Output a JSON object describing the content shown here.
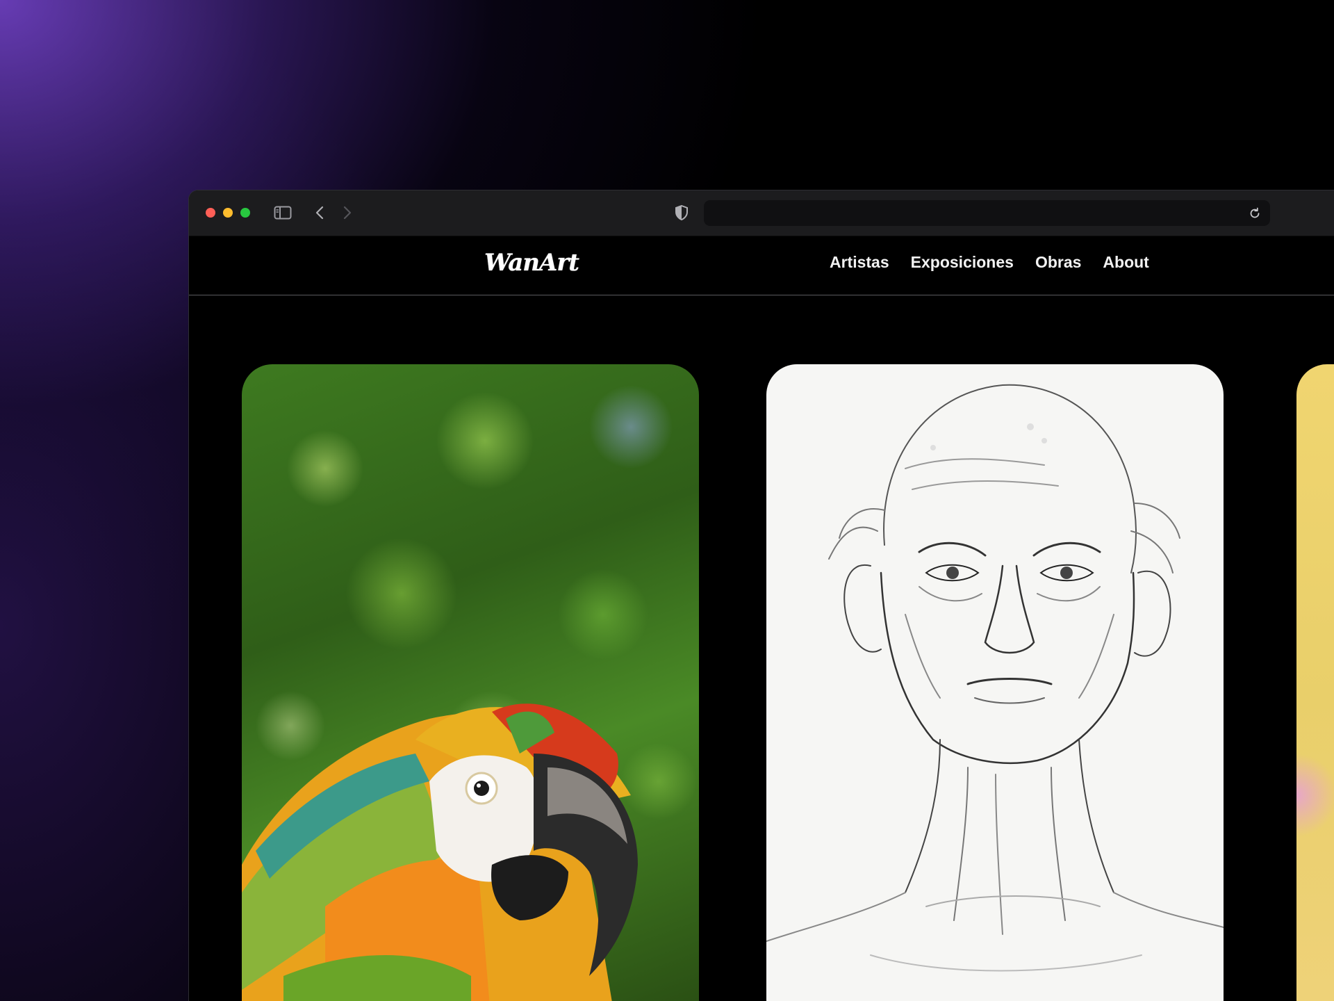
{
  "browser": {
    "traffic_lights": {
      "close_color": "#ff5f57",
      "minimize_color": "#febc2e",
      "maximize_color": "#28c840"
    },
    "toolbar_icons": [
      "sidebar-toggle-icon",
      "chevron-left-icon",
      "chevron-right-icon",
      "shield-icon",
      "reload-icon"
    ],
    "address_bar": {
      "value": ""
    }
  },
  "site": {
    "logo": "WanArt",
    "nav": {
      "items": [
        {
          "label": "Artistas"
        },
        {
          "label": "Exposiciones"
        },
        {
          "label": "Obras"
        },
        {
          "label": "About"
        }
      ]
    }
  },
  "gallery": {
    "cards": [
      {
        "subject": "parrot photo"
      },
      {
        "subject": "pencil portrait"
      },
      {
        "subject": "abstract yellow artwork"
      }
    ]
  },
  "colors": {
    "page_background": "#000000",
    "toolbar": "#1c1c1e",
    "accent_purple": "#7846d2"
  }
}
